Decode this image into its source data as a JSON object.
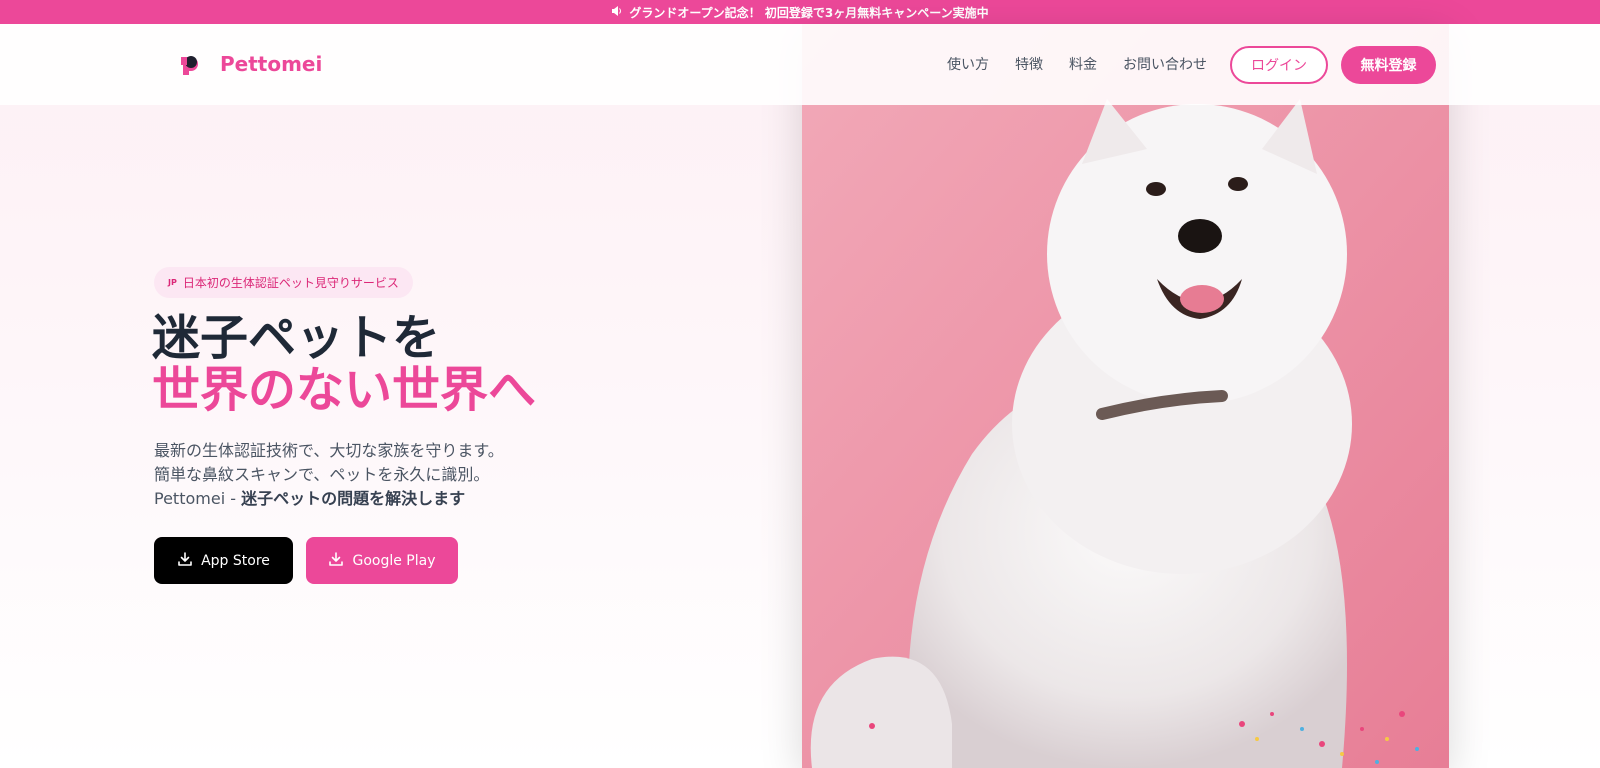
{
  "announcement": {
    "icon": "speaker-icon",
    "text": "グランドオープン記念！ 初回登録で3ヶ月無料キャンペーン実施中"
  },
  "brand": {
    "name": "Pettomei",
    "accent_color": "#ec4899"
  },
  "nav": {
    "items": [
      "使い方",
      "特徴",
      "料金",
      "お問い合わせ"
    ],
    "login_label": "ログイン",
    "register_label": "無料登録"
  },
  "hero": {
    "badge_flag": "JP",
    "badge_text": "日本初の生体認証ペット見守りサービス",
    "headline_line1": "迷子ペットを",
    "headline_line2": "世界のない世界へ",
    "desc_line1": "最新の生体認証技術で、大切な家族を守ります。",
    "desc_line2": "簡単な鼻紋スキャンで、ペットを永久に識別。",
    "desc_line3_prefix": "Pettomei - ",
    "desc_line3_bold": "迷子ペットの問題を解決します",
    "appstore_label": "App Store",
    "googleplay_label": "Google Play"
  }
}
